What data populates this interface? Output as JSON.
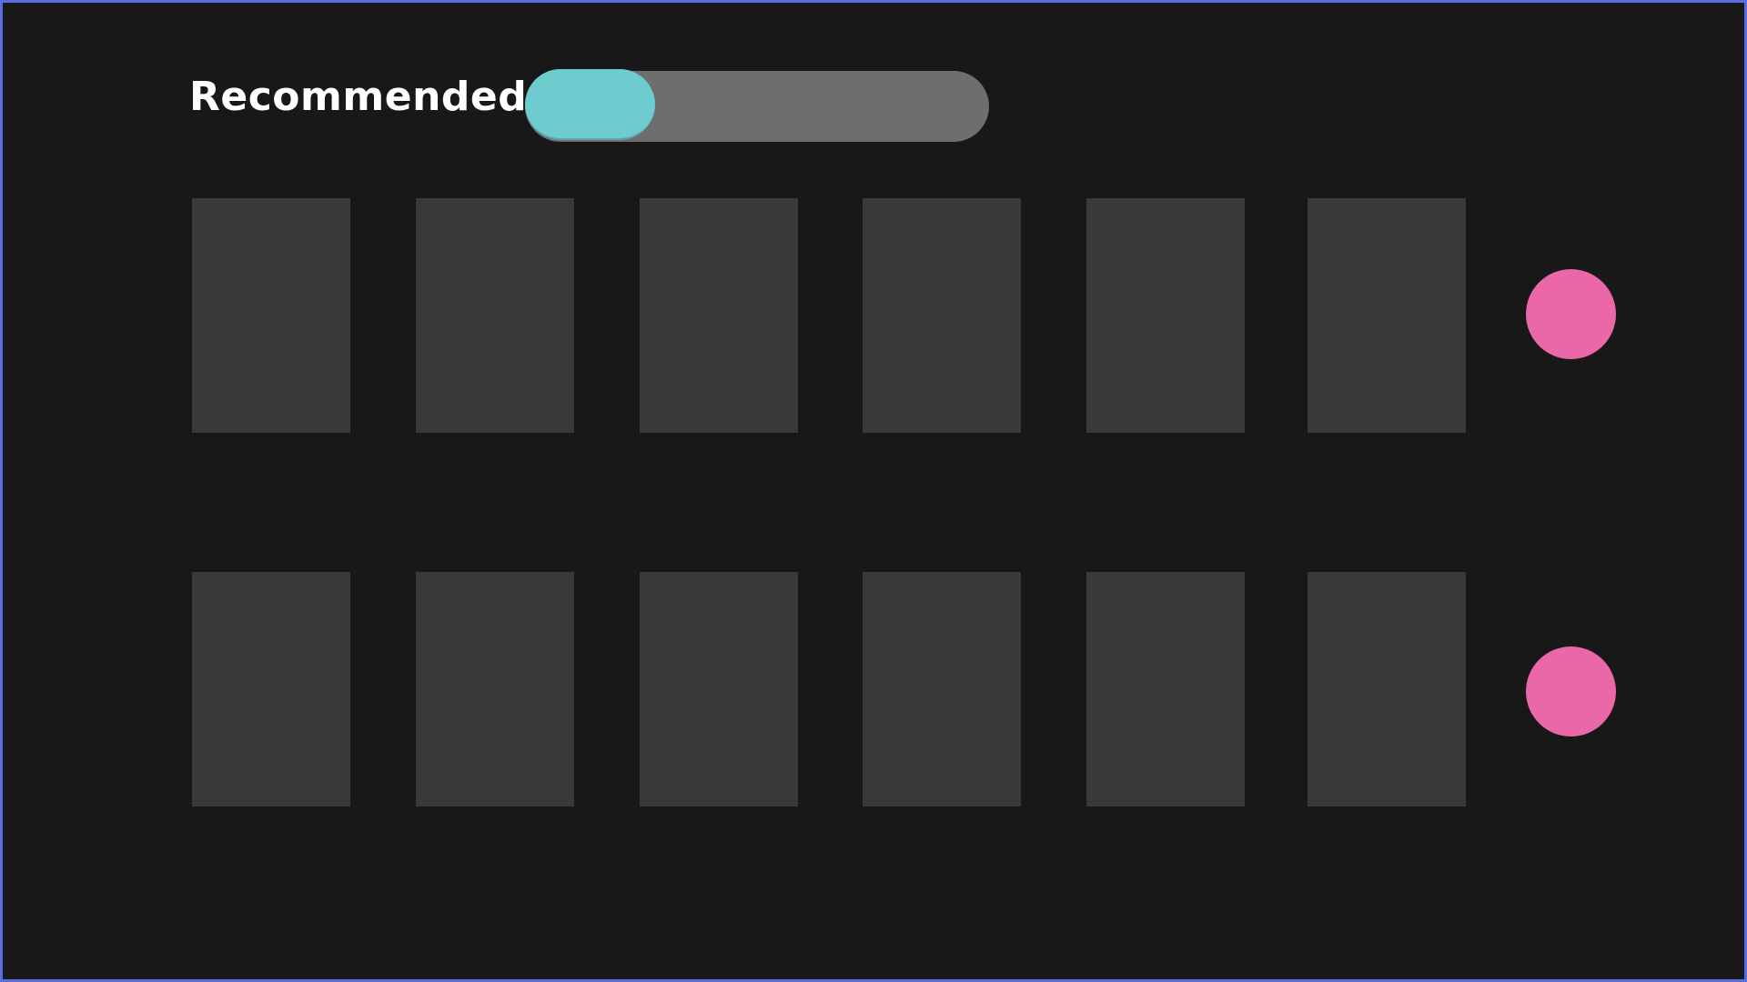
{
  "header": {
    "title": "Recommended",
    "toggle": {
      "accent_color": "#6ecbce",
      "track_color": "#6e6e6e",
      "state": "on-left"
    }
  },
  "rows": [
    {
      "cards": [
        {
          "placeholder": true
        },
        {
          "placeholder": true
        },
        {
          "placeholder": true
        },
        {
          "placeholder": true
        },
        {
          "placeholder": true
        },
        {
          "placeholder": true
        }
      ],
      "action_color": "#eb68a8"
    },
    {
      "cards": [
        {
          "placeholder": true
        },
        {
          "placeholder": true
        },
        {
          "placeholder": true
        },
        {
          "placeholder": true
        },
        {
          "placeholder": true
        },
        {
          "placeholder": true
        }
      ],
      "action_color": "#eb68a8"
    }
  ],
  "colors": {
    "background": "#181818",
    "card": "#393939",
    "border": "#5b6ee1"
  }
}
